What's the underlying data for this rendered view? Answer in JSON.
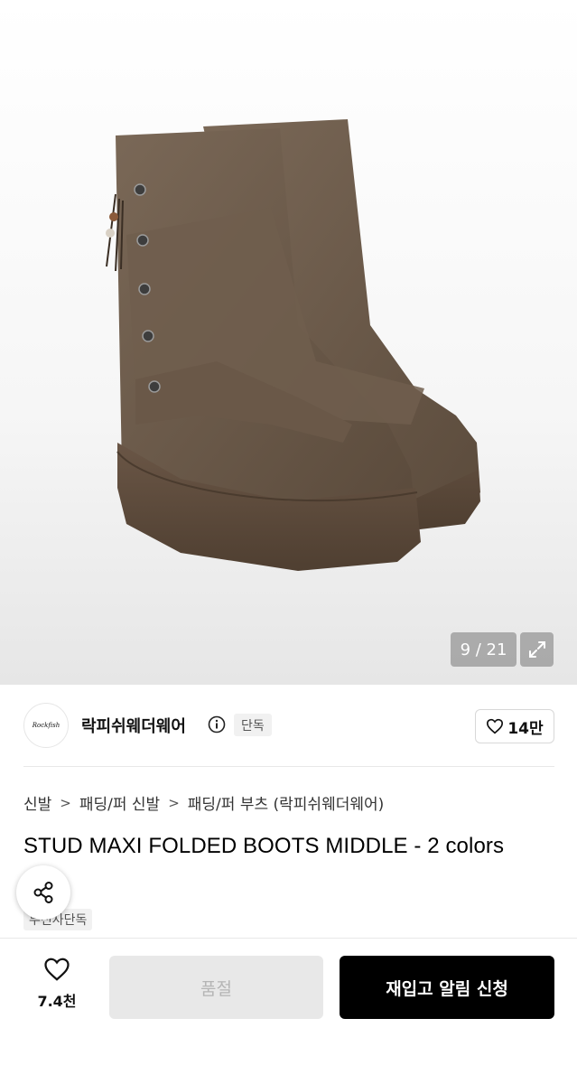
{
  "gallery": {
    "counter": "9 / 21",
    "expand_icon": "expand-icon",
    "image_subject": "boot-product-image"
  },
  "brand": {
    "logo_text": "Rockfish",
    "name": "락피쉬웨더웨어",
    "info_icon": "info-icon",
    "badge": "단독",
    "likes": "14만"
  },
  "breadcrumb": [
    "신발",
    "패딩/퍼 신발",
    "패딩/퍼 부츠 (락피쉬웨더웨어)"
  ],
  "product": {
    "title": "STUD MAXI FOLDED BOOTS MIDDLE - 2 colors",
    "tag": "무신사단독"
  },
  "bottom_bar": {
    "wish_count": "7.4천",
    "soldout_label": "품절",
    "restock_label": "재입고 알림 신청"
  },
  "colors": {
    "primary_button": "#000000",
    "disabled_button": "#e8e8e8",
    "boot": "#6b5a4a"
  }
}
